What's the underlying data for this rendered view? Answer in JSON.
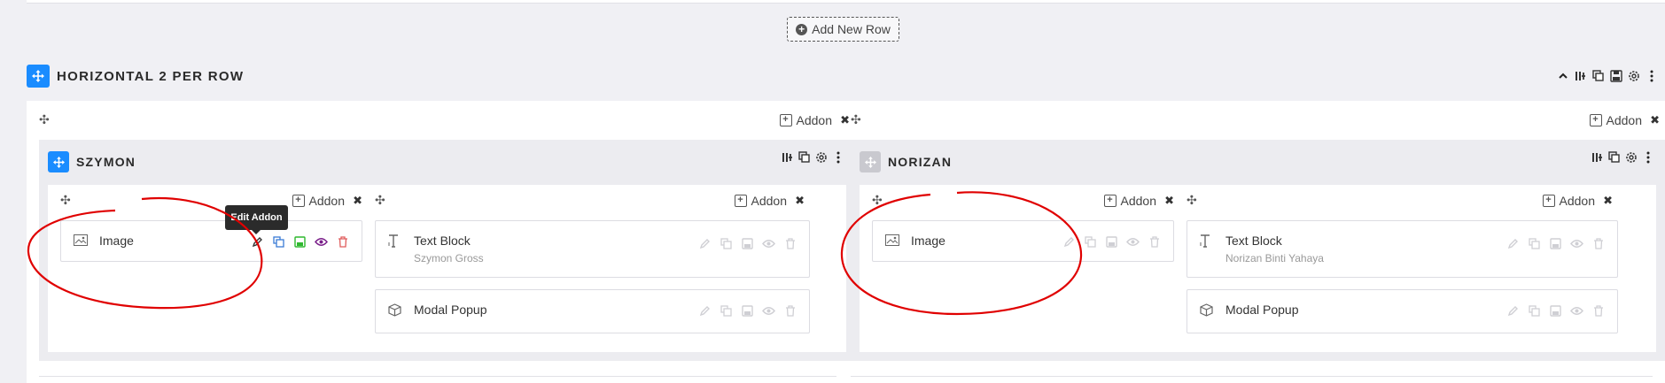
{
  "toolbar": {
    "add_row_label": "Add New Row"
  },
  "section": {
    "title": "HORIZONTAL 2 PER ROW"
  },
  "columns": [
    {
      "addon_label": "Addon",
      "row": {
        "title": "SZYMON",
        "columns": [
          {
            "addon_label": "Addon",
            "addons": [
              {
                "name": "Image",
                "subtitle": ""
              }
            ]
          },
          {
            "addon_label": "Addon",
            "addons": [
              {
                "name": "Text Block",
                "subtitle": "Szymon Gross"
              },
              {
                "name": "Modal Popup",
                "subtitle": ""
              }
            ]
          }
        ]
      }
    },
    {
      "addon_label": "Addon",
      "row": {
        "title": "NORIZAN",
        "columns": [
          {
            "addon_label": "Addon",
            "addons": [
              {
                "name": "Image",
                "subtitle": ""
              }
            ]
          },
          {
            "addon_label": "Addon",
            "addons": [
              {
                "name": "Text Block",
                "subtitle": "Norizan Binti Yahaya"
              },
              {
                "name": "Modal Popup",
                "subtitle": ""
              }
            ]
          }
        ]
      }
    }
  ],
  "tooltip": {
    "text": "Edit Addon"
  },
  "icons": {
    "move": "move-arrows-icon",
    "image": "image-icon",
    "text": "text-block-icon",
    "modal": "cube-icon",
    "edit": "pencil-icon",
    "duplicate": "duplicate-icon",
    "save": "save-icon",
    "visibility": "eye-icon",
    "delete": "trash-icon"
  },
  "colors": {
    "accent": "#1a8cff",
    "annotation": "#e00000",
    "edit_active": "#333333",
    "duplicate_active": "#3a7bd5",
    "save_active": "#2eb82e",
    "visibility_active": "#7a1f8a",
    "delete_active": "#e05c5c"
  }
}
